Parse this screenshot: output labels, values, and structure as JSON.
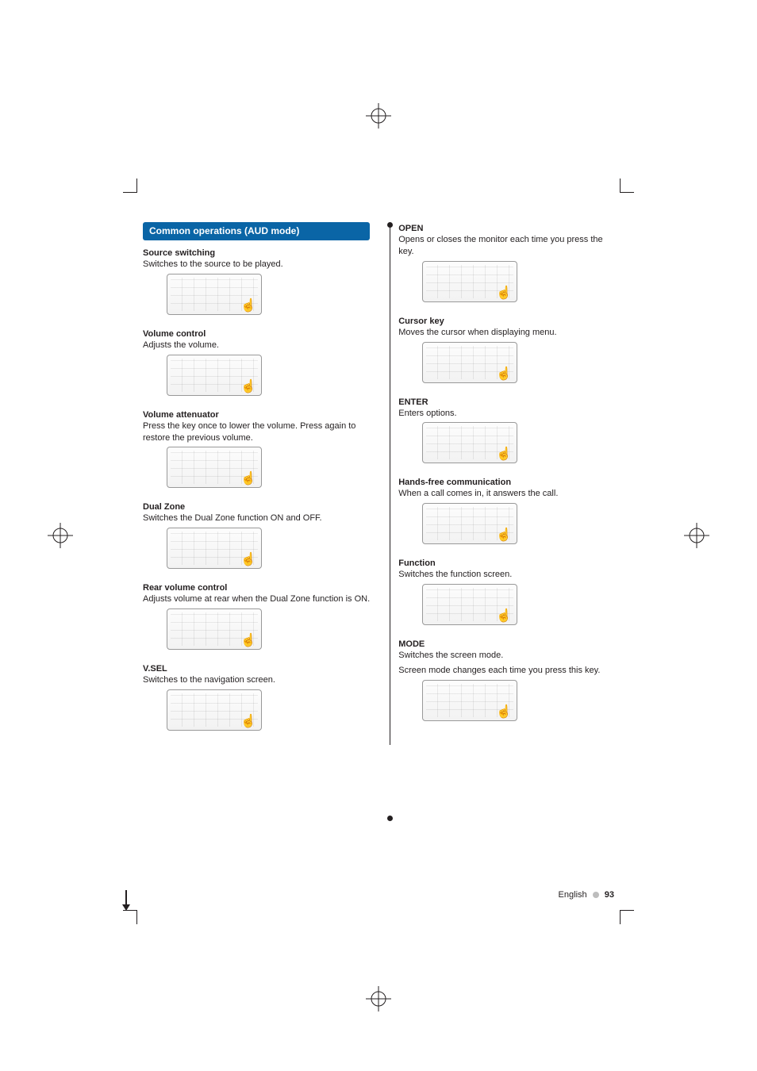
{
  "header": {
    "mode_label": "Common operations (AUD mode)"
  },
  "left": {
    "source_switching": {
      "title": "Source switching",
      "body": "Switches to the source to be played."
    },
    "volume_control": {
      "title": "Volume control",
      "body": "Adjusts the volume."
    },
    "volume_attenuator": {
      "title": "Volume attenuator",
      "body": "Press the key once to lower the volume. Press again to restore the previous volume."
    },
    "dual_zone": {
      "title": "Dual Zone",
      "body": "Switches the Dual Zone function ON and OFF."
    },
    "rear_volume": {
      "title": "Rear volume control",
      "body": "Adjusts volume at rear when the Dual Zone function is ON."
    },
    "vsel": {
      "title": "V.SEL",
      "body": "Switches to the navigation screen."
    }
  },
  "right": {
    "open": {
      "title": "OPEN",
      "body": "Opens or closes the monitor each time you press the key."
    },
    "cursor_key": {
      "title": "Cursor key",
      "body": "Moves the cursor when displaying menu."
    },
    "enter": {
      "title": "ENTER",
      "body": "Enters options."
    },
    "hands_free": {
      "title": "Hands-free communication",
      "body": "When a call comes in, it answers the call."
    },
    "function": {
      "title": "Function",
      "body": "Switches the function screen."
    },
    "mode": {
      "title": "MODE",
      "body1": "Switches the screen mode.",
      "body2": "Screen mode changes each time you press this key."
    }
  },
  "footer": {
    "lang": "English",
    "page": "93"
  },
  "icons": {
    "hand": "☝"
  }
}
